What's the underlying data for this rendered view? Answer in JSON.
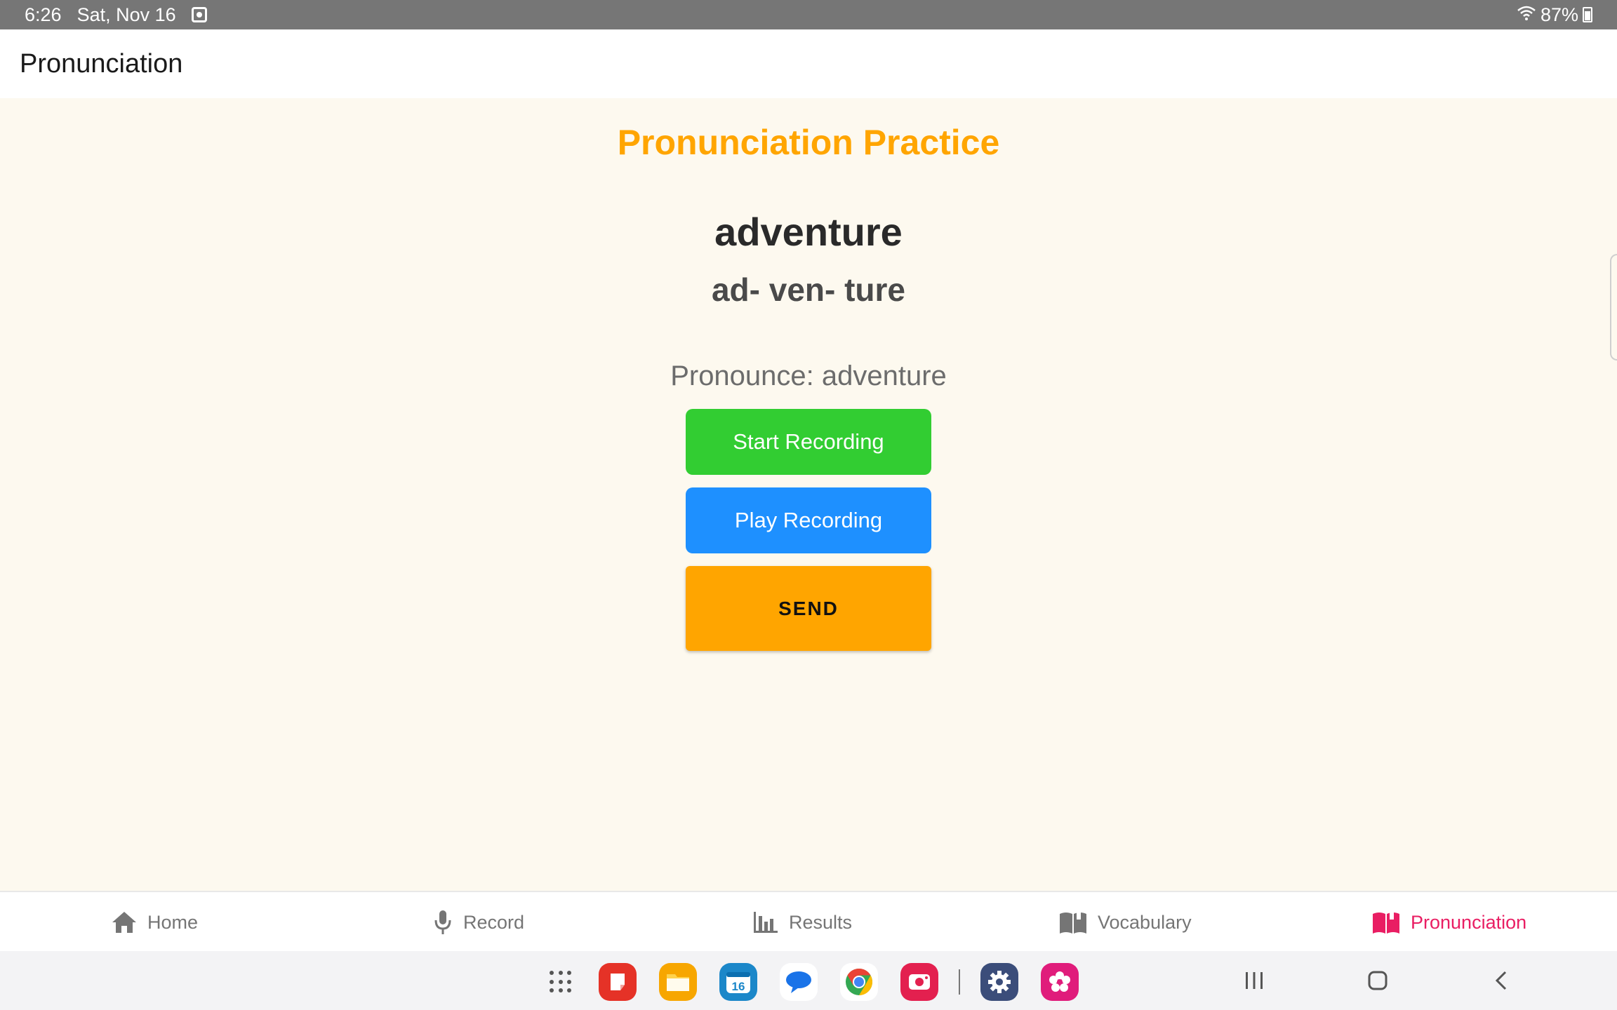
{
  "status_bar": {
    "time": "6:26",
    "date": "Sat, Nov 16",
    "battery": "87%"
  },
  "app_bar": {
    "title": "Pronunciation"
  },
  "main": {
    "heading": "Pronunciation Practice",
    "word": "adventure",
    "syllables": "ad- ven- ture",
    "prompt": "Pronounce: adventure",
    "start_button": "Start Recording",
    "play_button": "Play Recording",
    "send_button": "SEND"
  },
  "bottom_nav": {
    "items": [
      {
        "label": "Home",
        "icon": "home-icon"
      },
      {
        "label": "Record",
        "icon": "microphone-icon"
      },
      {
        "label": "Results",
        "icon": "bar-chart-icon"
      },
      {
        "label": "Vocabulary",
        "icon": "book-icon"
      },
      {
        "label": "Pronunciation",
        "icon": "book-icon",
        "active": true
      }
    ]
  },
  "dock": {
    "apps": [
      "apps-grid",
      "notes",
      "files",
      "calendar",
      "messages",
      "chrome",
      "screen-recorder",
      "settings",
      "gallery"
    ],
    "calendar_day": "16"
  },
  "colors": {
    "accent": "#ffa500",
    "start": "#32cd32",
    "play": "#1e90ff",
    "active_nav": "#e91e63",
    "background": "#fdf9ef"
  }
}
